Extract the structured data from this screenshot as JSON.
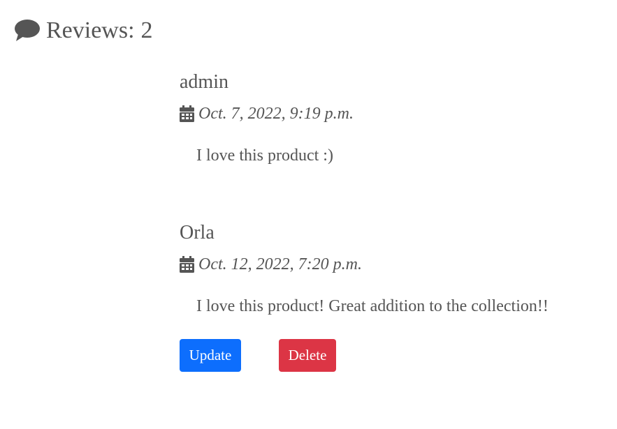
{
  "header": {
    "icon": "comment-icon",
    "label": "Reviews:",
    "count": "2"
  },
  "reviews": [
    {
      "author": "admin",
      "date_icon": "calendar-icon",
      "date": "Oct. 7, 2022, 9:19 p.m.",
      "body": "I love this product :)"
    },
    {
      "author": "Orla",
      "date_icon": "calendar-icon",
      "date": "Oct. 12, 2022, 7:20 p.m.",
      "body": "I love this product! Great addition to the collection!!"
    }
  ],
  "actions": {
    "update_label": "Update",
    "delete_label": "Delete",
    "update_color": "#0d6efd",
    "delete_color": "#dc3545"
  }
}
